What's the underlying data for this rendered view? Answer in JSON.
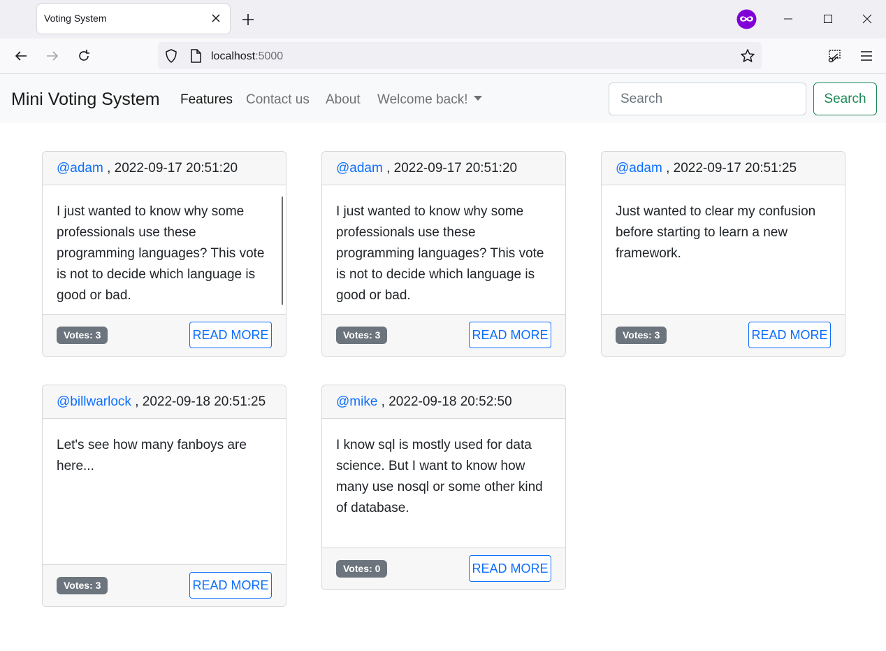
{
  "browser": {
    "tab_title": "Voting System",
    "url_host": "localhost",
    "url_port": ":5000"
  },
  "site": {
    "brand": "Mini Voting System",
    "nav": {
      "features": "Features",
      "contact": "Contact us",
      "about": "About",
      "welcome": "Welcome back!"
    },
    "search": {
      "placeholder": "Search",
      "button": "Search"
    }
  },
  "cards": [
    {
      "user": "@adam",
      "timestamp": " , 2022-09-17 20:51:20",
      "body": "I just wanted to know why some professionals use these programming languages? This vote is not to decide which language is good or bad.",
      "votes": "Votes: 3",
      "button": "READ MORE"
    },
    {
      "user": "@adam",
      "timestamp": " , 2022-09-17 20:51:20",
      "body": "I just wanted to know why some professionals use these programming languages? This vote is not to decide which language is good or bad.",
      "votes": "Votes: 3",
      "button": "READ MORE"
    },
    {
      "user": "@adam",
      "timestamp": " , 2022-09-17 20:51:25",
      "body": "Just wanted to clear my confusion before starting to learn a new framework.",
      "votes": "Votes: 3",
      "button": "READ MORE"
    },
    {
      "user": "@billwarlock",
      "timestamp": " , 2022-09-18 20:51:25",
      "body": "Let's see how many fanboys are here...",
      "votes": "Votes: 3",
      "button": "READ MORE"
    },
    {
      "user": "@mike",
      "timestamp": " , 2022-09-18 20:52:50",
      "body": "I know sql is mostly used for data science. But I want to know how many use nosql or some other kind of database.",
      "votes": "Votes: 0",
      "button": "READ MORE"
    }
  ]
}
